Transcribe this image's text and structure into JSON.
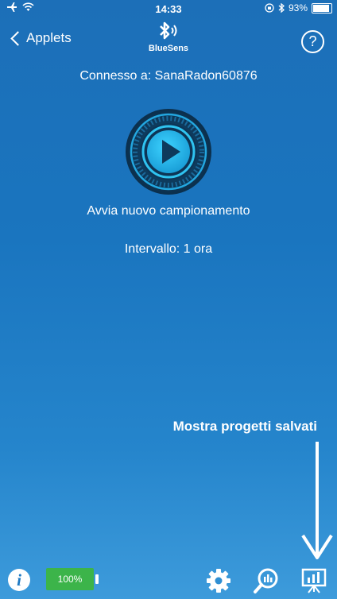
{
  "status_bar": {
    "time": "14:33",
    "battery_percent": "93%",
    "battery_level": 0.93
  },
  "nav": {
    "back_label": "Applets",
    "brand_name": "BlueSens",
    "help_label": "?"
  },
  "main": {
    "connection_text": "Connesso a: SanaRadon60876",
    "start_label": "Avvia nuovo campionamento",
    "interval_text": "Intervallo: 1 ora"
  },
  "annotation": {
    "text": "Mostra progetti salvati"
  },
  "toolbar": {
    "info_label": "i",
    "device_battery_text": "100%",
    "device_battery_level": 1.0,
    "icons": [
      "settings-icon",
      "search-chart-icon",
      "saved-projects-icon"
    ]
  },
  "colors": {
    "background_top": "#1c6fb8",
    "background_bottom": "#3d9bdb",
    "accent_cyan": "#2fc3f0",
    "battery_green": "#3cb44a"
  }
}
